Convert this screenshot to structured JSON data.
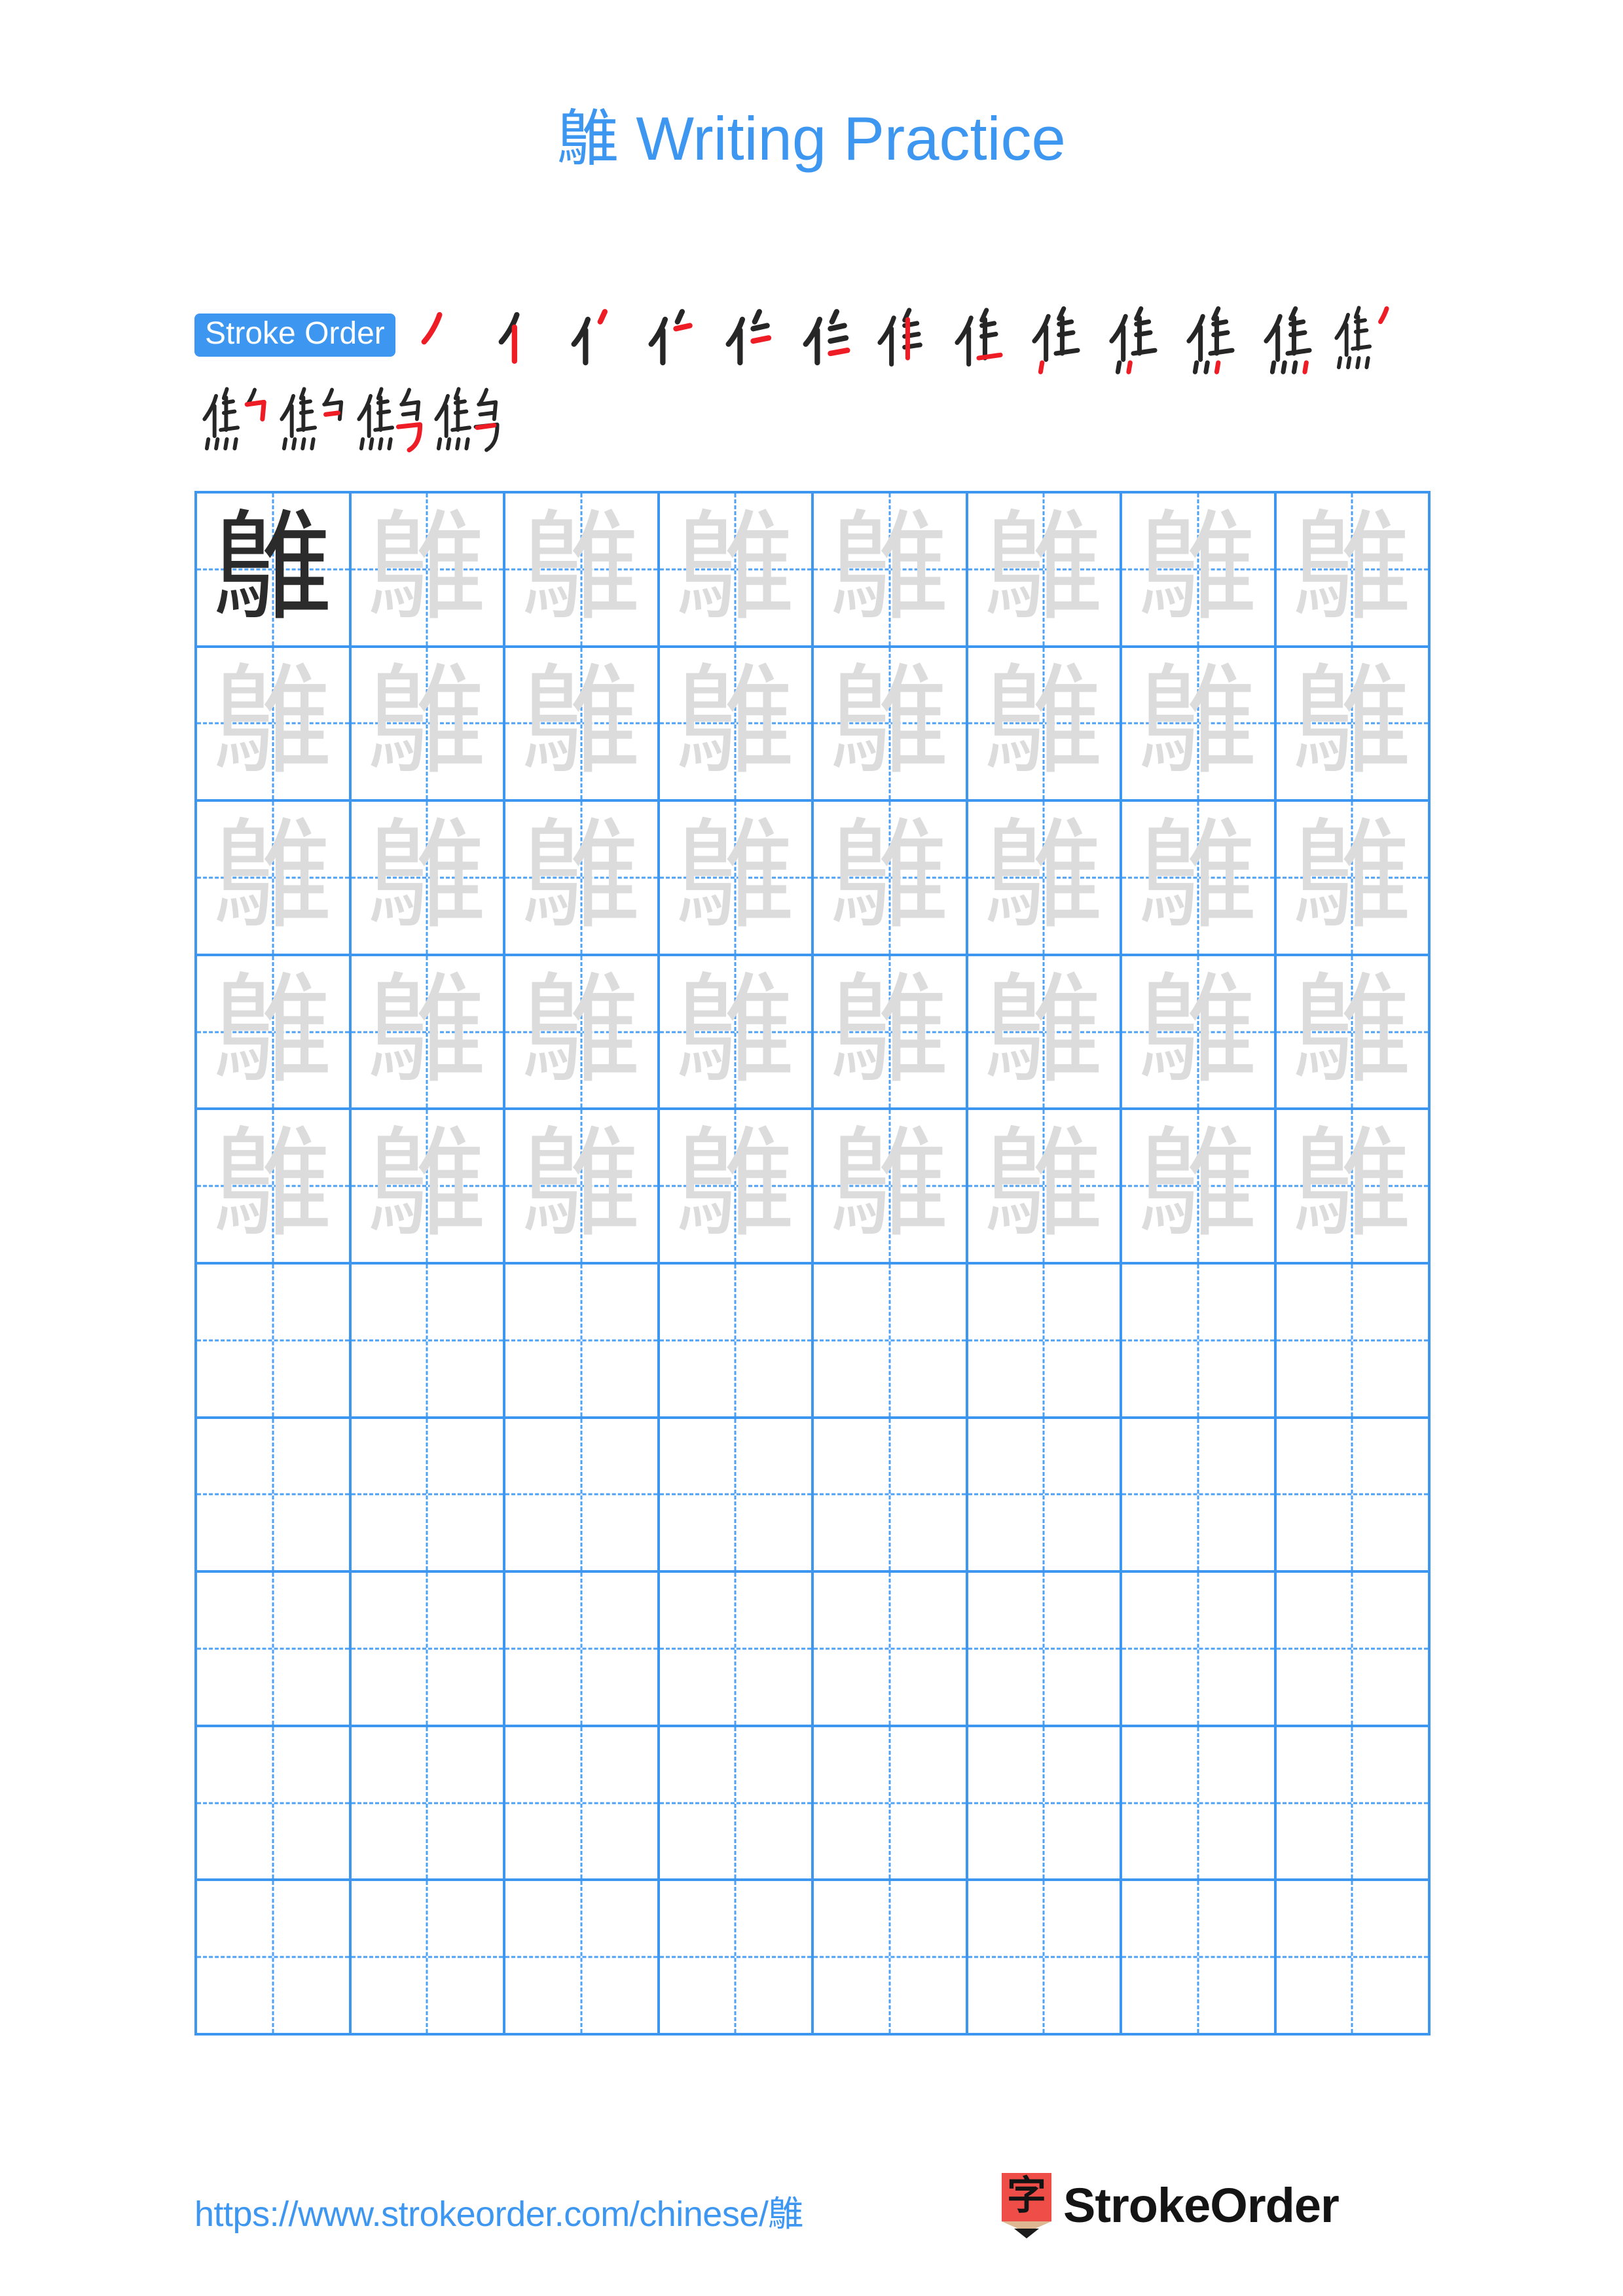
{
  "document": {
    "character": "鵻",
    "title_suffix": " Writing Practice",
    "title_full": "鵻 Writing Practice"
  },
  "colors": {
    "accent_blue": "#3d96f0",
    "grid_line": "#3d96f0",
    "guide_dash": "#4da2f5",
    "trace_gray": "#dcdcdc",
    "model_dark": "#2b2b2b",
    "stroke_black": "#262626",
    "stroke_new_red": "#ee1c25",
    "logo_red": "#ef4e48",
    "logo_wood": "#ddb892"
  },
  "stroke_order": {
    "label": "Stroke Order",
    "total_strokes": 17,
    "steps": [
      {
        "index": 1,
        "glyph": "丿"
      },
      {
        "index": 2,
        "glyph": "亻"
      },
      {
        "index": 3,
        "glyph": "ｲ丶"
      },
      {
        "index": 4,
        "glyph": "ｲ冫"
      },
      {
        "index": 5,
        "glyph": "ｲ彡"
      },
      {
        "index": 6,
        "glyph": "ｲ彡"
      },
      {
        "index": 7,
        "glyph": "隹"
      },
      {
        "index": 8,
        "glyph": "隹"
      },
      {
        "index": 9,
        "glyph": "隹"
      },
      {
        "index": 10,
        "glyph": "隹"
      },
      {
        "index": 11,
        "glyph": "焦"
      },
      {
        "index": 12,
        "glyph": "焦"
      },
      {
        "index": 13,
        "glyph": "隹灬丿"
      },
      {
        "index": 14,
        "glyph": "鳥"
      },
      {
        "index": 15,
        "glyph": "鳥"
      },
      {
        "index": 16,
        "glyph": "鵻"
      },
      {
        "index": 17,
        "glyph": "鵻"
      }
    ]
  },
  "practice_grid": {
    "columns": 8,
    "rows": 10,
    "filled_rows": 5,
    "empty_rows": 5,
    "model_cell": {
      "row": 1,
      "col": 1,
      "character": "鵻"
    },
    "trace_character": "鵻"
  },
  "footer": {
    "url": "https://www.strokeorder.com/chinese/鵻",
    "brand_name": "StrokeOrder",
    "brand_mark_character": "字"
  }
}
